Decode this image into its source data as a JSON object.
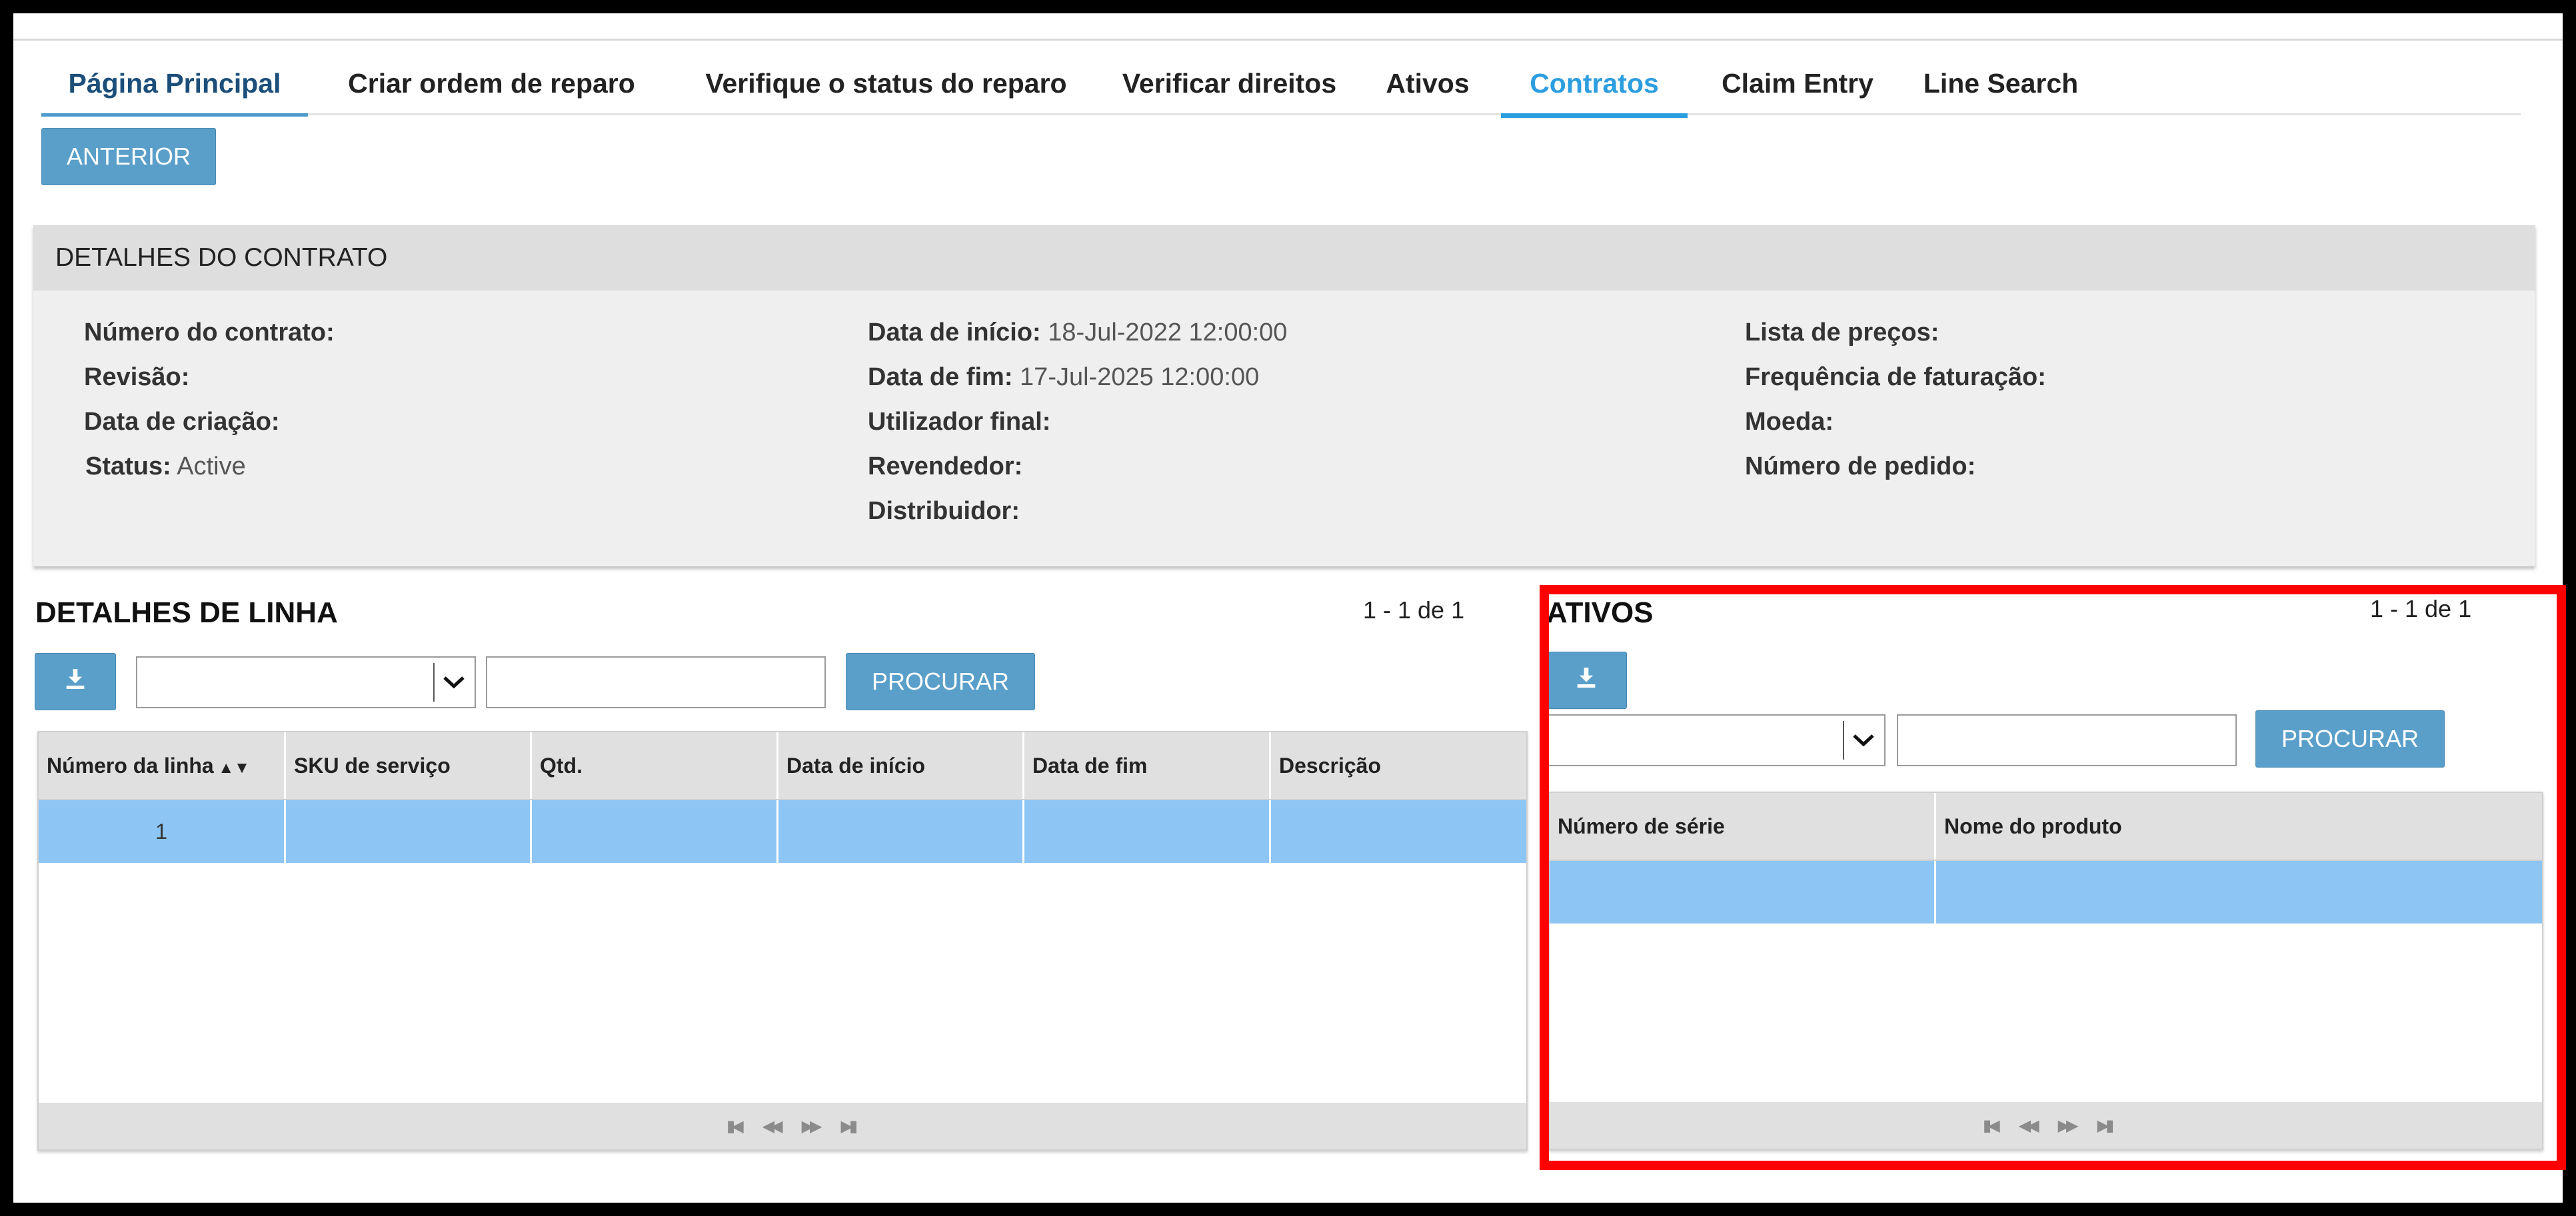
{
  "tabs": [
    {
      "label": "Página Principal"
    },
    {
      "label": "Criar ordem de reparo"
    },
    {
      "label": "Verifique o status do reparo"
    },
    {
      "label": "Verificar direitos"
    },
    {
      "label": "Ativos"
    },
    {
      "label": "Contratos"
    },
    {
      "label": "Claim Entry"
    },
    {
      "label": "Line Search"
    }
  ],
  "toolbar": {
    "back_label": "ANTERIOR"
  },
  "contract": {
    "title": "DETALHES DO CONTRATO",
    "col1": {
      "numero_label": "Número do contrato:",
      "revisao_label": "Revisão:",
      "criacao_label": "Data de criação:",
      "status_label": "Status:",
      "status_value": "Active"
    },
    "col2": {
      "inicio_label": "Data de início:",
      "inicio_value": "18-Jul-2022 12:00:00",
      "fim_label": "Data de fim:",
      "fim_value": "17-Jul-2025 12:00:00",
      "utilizador_label": "Utilizador final:",
      "revendedor_label": "Revendedor:",
      "distribuidor_label": "Distribuidor:"
    },
    "col3": {
      "precos_label": "Lista de preços:",
      "frequencia_label": "Frequência de faturação:",
      "moeda_label": "Moeda:",
      "pedido_label": "Número de pedido:"
    }
  },
  "lines": {
    "title": "DETALHES DE LINHA",
    "pager": "1 - 1 de 1",
    "search_label": "PROCURAR",
    "columns": [
      "Número da linha",
      "SKU de serviço",
      "Qtd.",
      "Data de início",
      "Data de fim",
      "Descrição"
    ],
    "rows": [
      {
        "numero": "1"
      }
    ]
  },
  "assets": {
    "title": "ATIVOS",
    "pager": "1 - 1 de 1",
    "search_label": "PROCURAR",
    "columns": [
      "Número de série",
      "Nome do produto"
    ]
  },
  "colors": {
    "accent": "#2c9ee0",
    "button": "#5a9fc9",
    "selected_row": "#8dc5f5",
    "highlight": "#ff0000"
  }
}
